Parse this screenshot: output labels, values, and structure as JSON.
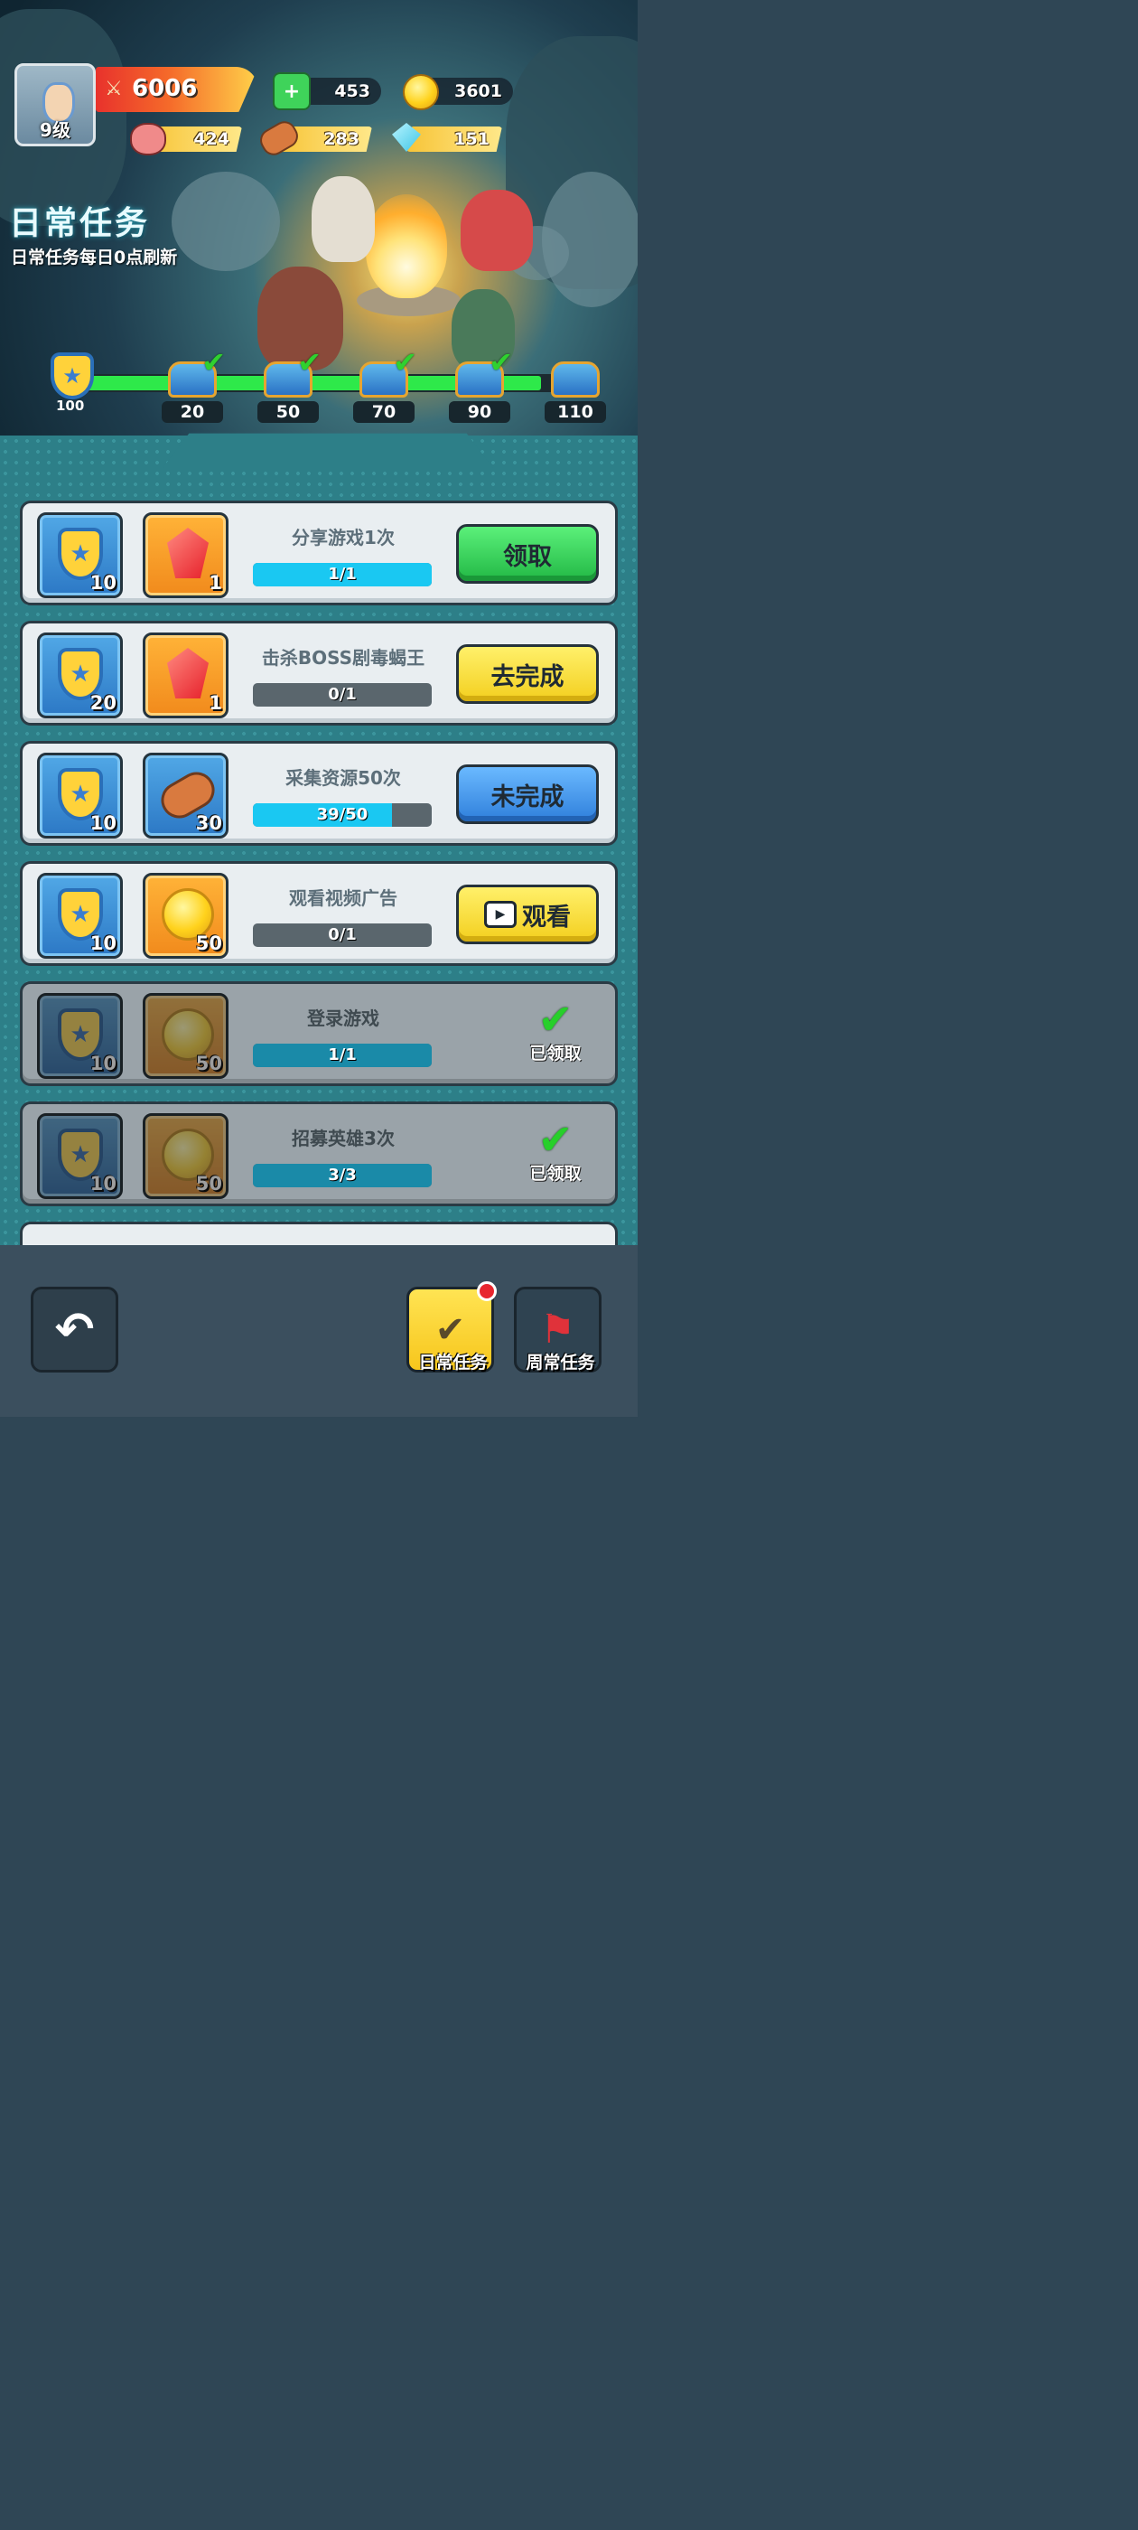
{
  "player": {
    "level": "9级",
    "power": "6006"
  },
  "currencies": {
    "green": "453",
    "gold": "3601"
  },
  "resources": {
    "meat": "424",
    "wood": "283",
    "crystal": "151"
  },
  "header": {
    "title": "日常任务",
    "subtitle": "日常任务每日0点刷新"
  },
  "milestones": {
    "current": "100",
    "progress": 0.93,
    "items": [
      {
        "label": "20",
        "claimed": true
      },
      {
        "label": "50",
        "claimed": true
      },
      {
        "label": "70",
        "claimed": true
      },
      {
        "label": "90",
        "claimed": true
      },
      {
        "label": "110",
        "claimed": false
      }
    ]
  },
  "tasks": [
    {
      "name": "分享游戏1次",
      "progress": "1/1",
      "ratio": 1.0,
      "reward1_qty": "10",
      "reward2_qty": "1",
      "reward2_icon": "gem-icon",
      "button": "领取",
      "button_style": "green"
    },
    {
      "name": "击杀BOSS剧毒蝎王",
      "progress": "0/1",
      "ratio": 0.0,
      "reward1_qty": "20",
      "reward2_qty": "1",
      "reward2_icon": "gem-icon",
      "button": "去完成",
      "button_style": "yellow"
    },
    {
      "name": "采集资源50次",
      "progress": "39/50",
      "ratio": 0.78,
      "reward1_qty": "10",
      "reward2_qty": "30",
      "reward2_icon": "wood-log-icon",
      "button": "未完成",
      "button_style": "blue"
    },
    {
      "name": "观看视频广告",
      "progress": "0/1",
      "ratio": 0.0,
      "reward1_qty": "10",
      "reward2_qty": "50",
      "reward2_icon": "gold-coin-icon",
      "button": "观看",
      "button_style": "yellow"
    },
    {
      "name": "登录游戏",
      "progress": "1/1",
      "ratio": 1.0,
      "reward1_qty": "10",
      "reward2_qty": "50",
      "reward2_icon": "gold-coin-icon",
      "status": "已领取"
    },
    {
      "name": "招募英雄3次",
      "progress": "3/3",
      "ratio": 1.0,
      "reward1_qty": "10",
      "reward2_qty": "50",
      "reward2_icon": "gold-coin-icon",
      "status": "已领取"
    }
  ],
  "footer": {
    "daily_label": "日常任务",
    "weekly_label": "周常任务"
  }
}
